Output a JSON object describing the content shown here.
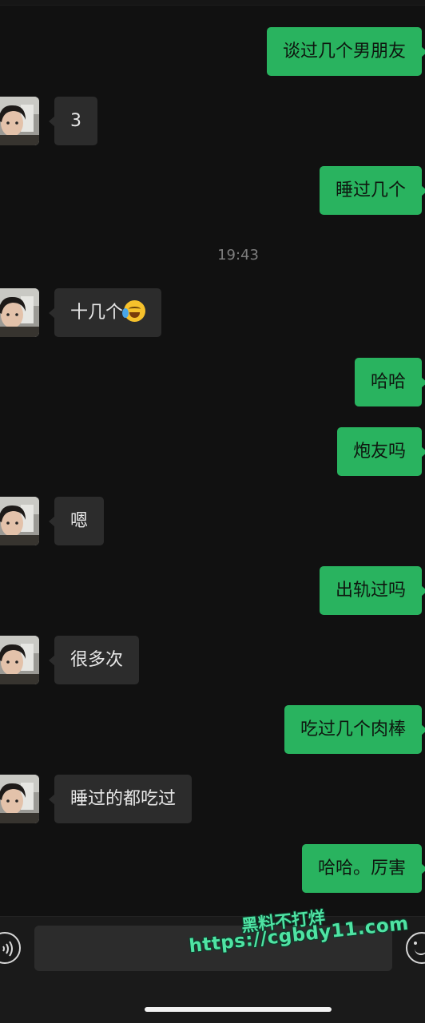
{
  "messages": [
    {
      "side": "out",
      "text": "谈过几个男朋友"
    },
    {
      "side": "in",
      "text": "3"
    },
    {
      "side": "out",
      "text": "睡过几个"
    },
    {
      "side": "in",
      "text": "十几个",
      "emoji": "crying-laughing-emoji"
    },
    {
      "side": "out",
      "text": "哈哈"
    },
    {
      "side": "out",
      "text": "炮友吗"
    },
    {
      "side": "in",
      "text": "嗯"
    },
    {
      "side": "out",
      "text": "出轨过吗"
    },
    {
      "side": "in",
      "text": "很多次"
    },
    {
      "side": "out",
      "text": "吃过几个肉棒"
    },
    {
      "side": "in",
      "text": "睡过的都吃过"
    },
    {
      "side": "out",
      "text": "哈哈。厉害"
    }
  ],
  "timestamp": "19:43",
  "input_bar": {
    "voice_icon": "voice-icon",
    "emoji_icon": "emoji-icon",
    "input_value": ""
  },
  "watermark": {
    "title": "黑料不打烊",
    "url": "https://cgbdy11.com"
  },
  "colors": {
    "background": "#111111",
    "incoming_bubble": "#2c2c2c",
    "outgoing_bubble": "#29b35f",
    "watermark": "#4fe3a3"
  }
}
